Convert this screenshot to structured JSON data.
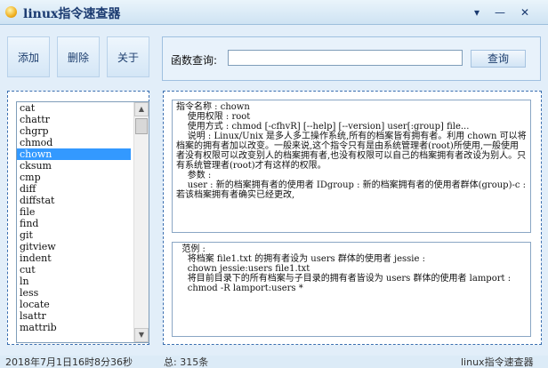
{
  "window": {
    "title": "linux指令速查器",
    "controls": [
      "▾",
      "—",
      "✕"
    ]
  },
  "buttons": {
    "add": "添加",
    "delete": "删除",
    "about": "关于"
  },
  "query": {
    "label": "函数查询:",
    "value": "",
    "button": "查询"
  },
  "commands": [
    "cat",
    "chattr",
    "chgrp",
    "chmod",
    "chown",
    "cksum",
    "cmp",
    "diff",
    "diffstat",
    "file",
    "find",
    "git",
    "gitview",
    "indent",
    "cut",
    "ln",
    "less",
    "locate",
    "lsattr",
    "mattrib"
  ],
  "selected_command": "chown",
  "info_lines": [
    "指令名称 : chown",
    "    使用权限 : root",
    "    使用方式 : chmod [-cfhvR] [--help] [--version] user[:group] file...",
    "    说明 : Linux/Unix 是多人多工操作系统,所有的档案皆有拥有者。利用 chown 可以将档案的拥有者加以改变。一般来说,这个指令只有是由系统管理者(root)所使用,一般使用者没有权限可以改变别人的档案拥有者,也没有权限可以自己的档案拥有者改设为别人。只有系统管理者(root)才有这样的权限。",
    "    参数 :",
    "    user : 新的档案拥有者的使用者 IDgroup : 新的档案拥有者的使用者群体(group)-c : 若该档案拥有者确实已经更改,"
  ],
  "example_lines": [
    "  范例 :",
    "    将档案 file1.txt 的拥有者设为 users 群体的使用者 jessie :",
    "    chown jessie:users file1.txt",
    "    将目前目录下的所有档案与子目录的拥有者皆设为 users 群体的使用者 lamport :",
    "    chmod -R lamport:users *"
  ],
  "status": {
    "datetime": "2018年7月1日16时8分36秒",
    "count": "总: 315条",
    "app": "linux指令速查器"
  }
}
